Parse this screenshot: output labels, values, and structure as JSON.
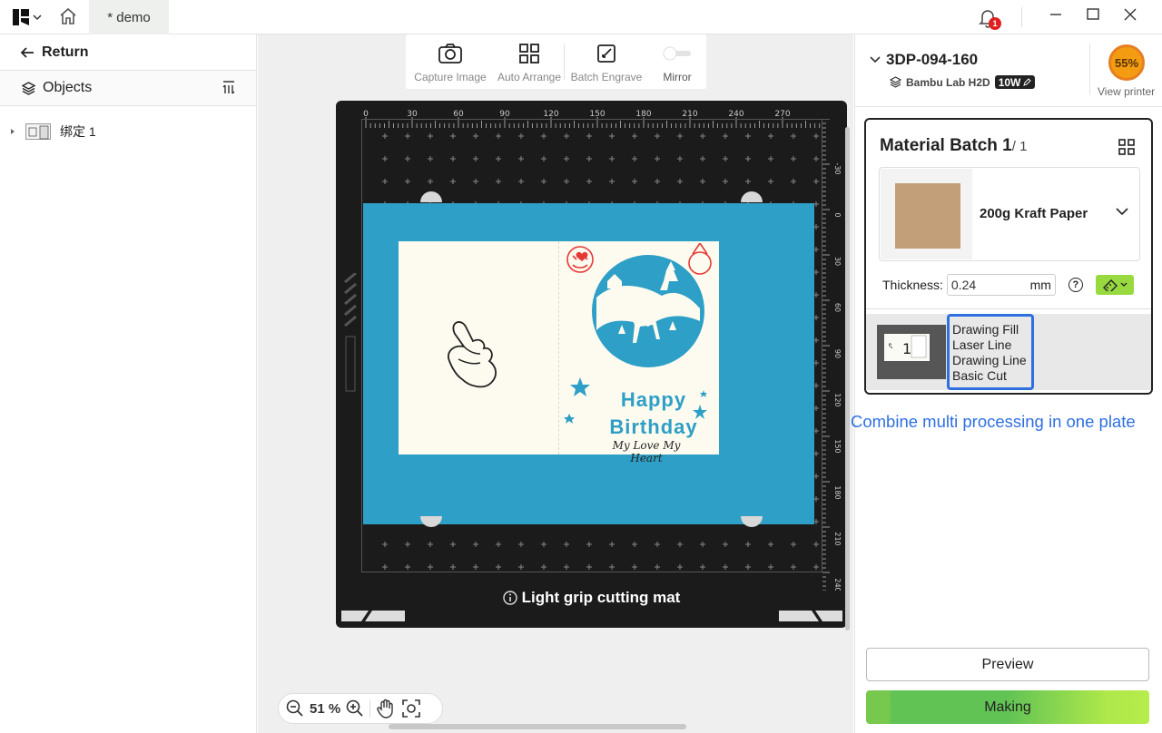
{
  "topbar": {
    "tab_title": "* demo",
    "notification_count": "1"
  },
  "left": {
    "return_label": "Return",
    "objects_label": "Objects",
    "tree_items": [
      {
        "label": "绑定 1"
      }
    ]
  },
  "toolbar": {
    "capture": "Capture Image",
    "auto_arrange": "Auto Arrange",
    "batch_engrave": "Batch Engrave",
    "mirror": "Mirror"
  },
  "mat": {
    "label": "Light grip cutting mat",
    "ruler_top": [
      "0",
      "30",
      "60",
      "90",
      "120",
      "150",
      "180",
      "210",
      "240",
      "270"
    ],
    "ruler_right": [
      "-30",
      "0",
      "30",
      "60",
      "90",
      "120",
      "150",
      "180",
      "210",
      "240"
    ],
    "card_text": {
      "happy": "Happy",
      "birthday": "Birthday",
      "script": "My Love My Heart"
    }
  },
  "zoom": {
    "value": "51 %"
  },
  "printer": {
    "name": "3DP-094-160",
    "model": "Bambu Lab H2D",
    "power": "10W",
    "progress": "55%",
    "view_label": "View printer"
  },
  "batch": {
    "title": "Material Batch 1",
    "count": "/ 1",
    "material_name": "200g Kraft Paper",
    "thickness_label": "Thickness:",
    "thickness_value": "0.24",
    "thickness_unit": "mm",
    "processes": [
      "Drawing Fill",
      "Laser Line",
      "Drawing Line",
      "Basic Cut"
    ]
  },
  "annotation": "Combine multi processing in one plate",
  "actions": {
    "preview": "Preview",
    "making": "Making"
  },
  "colors": {
    "accent_blue": "#2f6fe0",
    "paper_blue": "#2e9fc6",
    "making_green": "#62c355",
    "progress_orange": "#f39c12"
  }
}
